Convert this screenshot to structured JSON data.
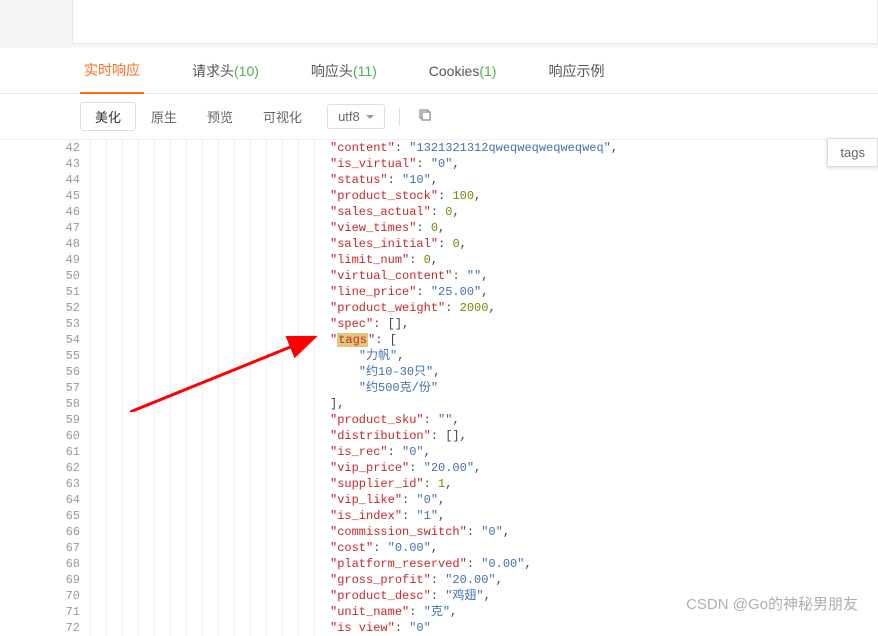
{
  "tabs": [
    {
      "label": "实时响应",
      "count": ""
    },
    {
      "label": "请求头",
      "count": "(10)"
    },
    {
      "label": "响应头",
      "count": "(11)"
    },
    {
      "label": "Cookies",
      "count": "(1)"
    },
    {
      "label": "响应示例",
      "count": ""
    }
  ],
  "active_tab_index": 0,
  "views": [
    "美化",
    "原生",
    "预览",
    "可视化"
  ],
  "active_view_index": 0,
  "encoding": "utf8",
  "search_text": "tags",
  "code_lines": [
    {
      "num": 42,
      "indent": 2,
      "key": "content",
      "sep": ": ",
      "val": "\"1321321312qweqweqweqweqweq\"",
      "vtype": "s",
      "trail": ","
    },
    {
      "num": 43,
      "indent": 2,
      "key": "is_virtual",
      "sep": ": ",
      "val": "\"0\"",
      "vtype": "s",
      "trail": ","
    },
    {
      "num": 44,
      "indent": 2,
      "key": "status",
      "sep": ": ",
      "val": "\"10\"",
      "vtype": "s",
      "trail": ","
    },
    {
      "num": 45,
      "indent": 2,
      "key": "product_stock",
      "sep": ": ",
      "val": "100",
      "vtype": "n",
      "trail": ","
    },
    {
      "num": 46,
      "indent": 2,
      "key": "sales_actual",
      "sep": ": ",
      "val": "0",
      "vtype": "n",
      "trail": ","
    },
    {
      "num": 47,
      "indent": 2,
      "key": "view_times",
      "sep": ": ",
      "val": "0",
      "vtype": "n",
      "trail": ","
    },
    {
      "num": 48,
      "indent": 2,
      "key": "sales_initial",
      "sep": ": ",
      "val": "0",
      "vtype": "n",
      "trail": ","
    },
    {
      "num": 49,
      "indent": 2,
      "key": "limit_num",
      "sep": ": ",
      "val": "0",
      "vtype": "n",
      "trail": ","
    },
    {
      "num": 50,
      "indent": 2,
      "key": "virtual_content",
      "sep": ": ",
      "val": "\"\"",
      "vtype": "s",
      "trail": ","
    },
    {
      "num": 51,
      "indent": 2,
      "key": "line_price",
      "sep": ": ",
      "val": "\"25.00\"",
      "vtype": "s",
      "trail": ","
    },
    {
      "num": 52,
      "indent": 2,
      "key": "product_weight",
      "sep": ": ",
      "val": "2000",
      "vtype": "n",
      "trail": ","
    },
    {
      "num": 53,
      "indent": 2,
      "key": "spec",
      "sep": ": ",
      "val": "[]",
      "vtype": "p",
      "trail": ","
    },
    {
      "num": 54,
      "indent": 2,
      "key": "tags",
      "sep": ": ",
      "val": "[",
      "vtype": "p",
      "trail": "",
      "highlight": true,
      "match": true
    },
    {
      "num": 55,
      "indent": 3,
      "key": "",
      "sep": "",
      "val": "\"力帆\"",
      "vtype": "s",
      "trail": ","
    },
    {
      "num": 56,
      "indent": 3,
      "key": "",
      "sep": "",
      "val": "\"约10-30只\"",
      "vtype": "s",
      "trail": ","
    },
    {
      "num": 57,
      "indent": 3,
      "key": "",
      "sep": "",
      "val": "\"约500克/份\"",
      "vtype": "s",
      "trail": ""
    },
    {
      "num": 58,
      "indent": 2,
      "key": "",
      "sep": "",
      "val": "]",
      "vtype": "p",
      "trail": ","
    },
    {
      "num": 59,
      "indent": 2,
      "key": "product_sku",
      "sep": ": ",
      "val": "\"\"",
      "vtype": "s",
      "trail": ","
    },
    {
      "num": 60,
      "indent": 2,
      "key": "distribution",
      "sep": ": ",
      "val": "[]",
      "vtype": "p",
      "trail": ","
    },
    {
      "num": 61,
      "indent": 2,
      "key": "is_rec",
      "sep": ": ",
      "val": "\"0\"",
      "vtype": "s",
      "trail": ","
    },
    {
      "num": 62,
      "indent": 2,
      "key": "vip_price",
      "sep": ": ",
      "val": "\"20.00\"",
      "vtype": "s",
      "trail": ","
    },
    {
      "num": 63,
      "indent": 2,
      "key": "supplier_id",
      "sep": ": ",
      "val": "1",
      "vtype": "n",
      "trail": ","
    },
    {
      "num": 64,
      "indent": 2,
      "key": "vip_like",
      "sep": ": ",
      "val": "\"0\"",
      "vtype": "s",
      "trail": ","
    },
    {
      "num": 65,
      "indent": 2,
      "key": "is_index",
      "sep": ": ",
      "val": "\"1\"",
      "vtype": "s",
      "trail": ","
    },
    {
      "num": 66,
      "indent": 2,
      "key": "commission_switch",
      "sep": ": ",
      "val": "\"0\"",
      "vtype": "s",
      "trail": ","
    },
    {
      "num": 67,
      "indent": 2,
      "key": "cost",
      "sep": ": ",
      "val": "\"0.00\"",
      "vtype": "s",
      "trail": ","
    },
    {
      "num": 68,
      "indent": 2,
      "key": "platform_reserved",
      "sep": ": ",
      "val": "\"0.00\"",
      "vtype": "s",
      "trail": ","
    },
    {
      "num": 69,
      "indent": 2,
      "key": "gross_profit",
      "sep": ": ",
      "val": "\"20.00\"",
      "vtype": "s",
      "trail": ","
    },
    {
      "num": 70,
      "indent": 2,
      "key": "product_desc",
      "sep": ": ",
      "val": "\"鸡翅\"",
      "vtype": "s",
      "trail": ","
    },
    {
      "num": 71,
      "indent": 2,
      "key": "unit_name",
      "sep": ": ",
      "val": "\"克\"",
      "vtype": "s",
      "trail": ","
    },
    {
      "num": 72,
      "indent": 2,
      "key": "is view",
      "sep": ": ",
      "val": "\"0\"",
      "vtype": "s",
      "trail": ""
    }
  ],
  "watermark": "CSDN @Go的神秘男朋友"
}
